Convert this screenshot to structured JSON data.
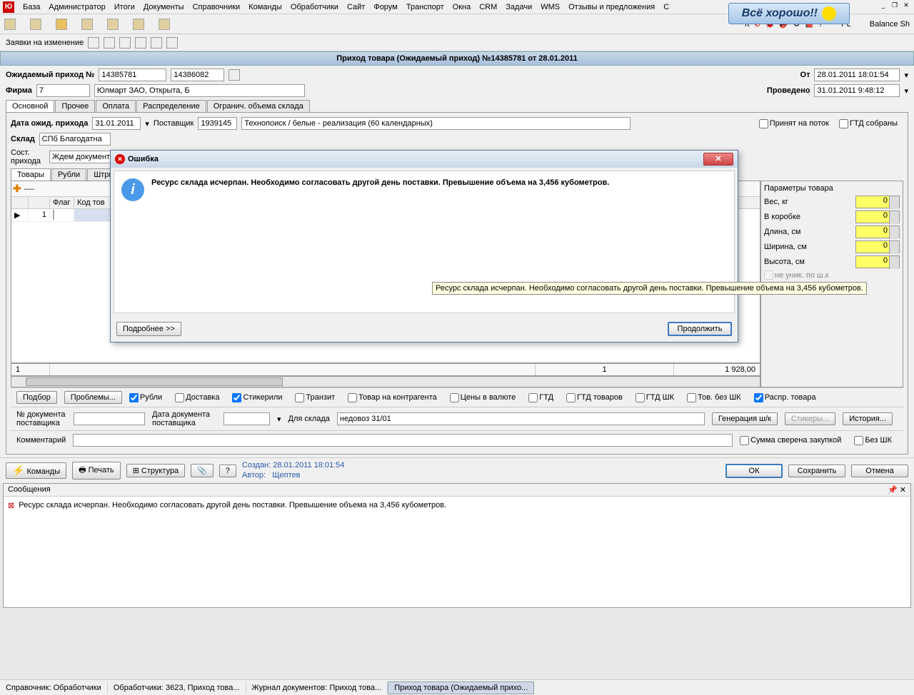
{
  "menu": [
    "База",
    "Администратор",
    "Итоги",
    "Документы",
    "Справочники",
    "Команды",
    "Обработчики",
    "Сайт",
    "Форум",
    "Транспорт",
    "Окна",
    "CRM",
    "Задачи",
    "WMS",
    "Отзывы и предложения",
    "С"
  ],
  "banner": "Всё хорошо!!",
  "right_tools": {
    "pl": "PL",
    "balance": "Balance Sh"
  },
  "subtoolbar_label": "Заявки на изменение",
  "doc_title": "Приход товара (Ожидаемый приход) №14385781 от 28.01.2011",
  "header": {
    "expected_label": "Ожидаемый приход №",
    "num1": "14385781",
    "num2": "14386082",
    "ot_label": "От",
    "ot_value": "28.01.2011 18:01:54",
    "firm_label": "Фирма",
    "firm_code": "7",
    "firm_name": "Юлмарт ЗАО, Открыта, Б",
    "done_label": "Проведено",
    "done_value": "31.01.2011 9:48:12"
  },
  "tabs_main": [
    "Основной",
    "Прочее",
    "Оплата",
    "Распределение",
    "Огранич. объема склада"
  ],
  "fields": {
    "date_label": "Дата ожид. прихода",
    "date_value": "31.01.2011",
    "supplier_label": "Поставщик",
    "supplier_code": "1939145",
    "supplier_name": "Технопоиск / белые - реализация (60 календарных)",
    "chk_potok": "Принят на поток",
    "chk_gtd": "ГТД собраны",
    "sklad_label": "Склад",
    "sklad_value": "СПб Благодатна",
    "sost_label": "Сост. прихода",
    "sost_value": "Ждем документы"
  },
  "tabs_inner": [
    "Товары",
    "Рубли",
    "Штрих-ко"
  ],
  "grid": {
    "cols": [
      "",
      "Флаг",
      "Код тов"
    ],
    "row1": "1",
    "sum_left": "1",
    "sum_mid": "1",
    "sum_right": "1 928,00"
  },
  "params": {
    "title": "Параметры товара",
    "rows": [
      {
        "label": "Вес, кг",
        "value": "0"
      },
      {
        "label": "В коробке",
        "value": "0"
      },
      {
        "label": "Длина, см",
        "value": "0"
      },
      {
        "label": "Ширина, см",
        "value": "0"
      },
      {
        "label": "Высота, см",
        "value": "0"
      }
    ],
    "chk1": "не уник. по ш.к",
    "chk2": "несоотв. опис."
  },
  "footer_checks": {
    "podbor": "Подбор",
    "problems": "Проблемы...",
    "cks": [
      "Рубли",
      "Доставка",
      "Стикерили",
      "Транзит",
      "Товар на контрагента",
      "Цены в валюте",
      "ГТД",
      "ГТД товаров",
      "ГТД ШК",
      "Тов. без ШК",
      "Распр. товара"
    ]
  },
  "footer_fields": {
    "doc_num_label": "№ документа поставщика",
    "doc_date_label": "Дата документа поставщика",
    "for_sklad_label": "Для склада",
    "for_sklad_value": "недовоз 31/01",
    "gen_sk": "Генерация ш/к",
    "stickers": "Стикеры...",
    "history": "История...",
    "comment_label": "Комментарий",
    "chk_sum": "Сумма сверена закупкой",
    "chk_bezshk": "Без ШК"
  },
  "action": {
    "commands": "Команды",
    "print": "Печать",
    "struct": "Структура",
    "created_label": "Создан:",
    "created_value": "28.01.2011 18:01:54",
    "author_label": "Автор:",
    "author_value": "Щептев",
    "ok": "ОК",
    "save": "Сохранить",
    "cancel": "Отмена"
  },
  "messages": {
    "title": "Сообщения",
    "text": "Ресурс склада исчерпан. Необходимо согласовать другой день поставки. Превышение объема на 3,456 кубометров."
  },
  "status": [
    "Справочник: Обработчики",
    "Обработчики: 3623, Приход това...",
    "Журнал документов: Приход това...",
    "Приход товара (Ожидаемый прихо..."
  ],
  "modal": {
    "title": "Ошибка",
    "text": "Ресурс склада исчерпан. Необходимо согласовать другой день поставки. Превышение объема на 3,456 кубометров.",
    "more": "Подробнее >>",
    "continue": "Продолжить"
  },
  "tooltip": "Ресурс склада исчерпан. Необходимо согласовать другой день поставки. Превышение объема на 3,456 кубометров."
}
